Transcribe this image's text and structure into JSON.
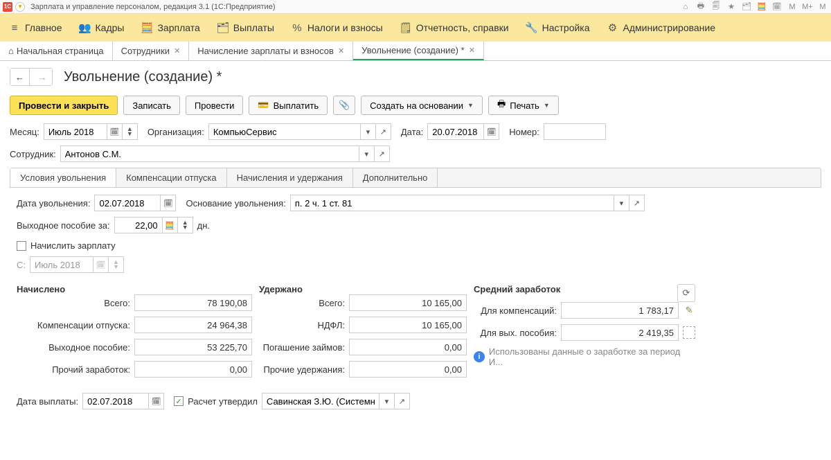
{
  "titlebar": {
    "title": "Зарплата и управление персоналом, редакция 3.1  (1С:Предприятие)",
    "right": [
      "⌂",
      "🖶",
      "🗐",
      "★",
      "🗂",
      "🧮",
      "🗓",
      "M",
      "M+",
      "M"
    ]
  },
  "menu": {
    "items": [
      {
        "icon": "≡",
        "label": "Главное"
      },
      {
        "icon": "👥",
        "label": "Кадры"
      },
      {
        "icon": "🧮",
        "label": "Зарплата"
      },
      {
        "icon": "🗂",
        "label": "Выплаты"
      },
      {
        "icon": "%",
        "label": "Налоги и взносы"
      },
      {
        "icon": "🗒",
        "label": "Отчетность, справки"
      },
      {
        "icon": "🔧",
        "label": "Настройка"
      },
      {
        "icon": "⚙",
        "label": "Администрирование"
      }
    ]
  },
  "tabs": {
    "home_label": "Начальная страница",
    "items": [
      {
        "label": "Сотрудники"
      },
      {
        "label": "Начисление зарплаты и взносов"
      },
      {
        "label": "Увольнение (создание) *",
        "active": true
      }
    ]
  },
  "heading": "Увольнение (создание) *",
  "toolbar": {
    "post_close": "Провести и закрыть",
    "save": "Записать",
    "post": "Провести",
    "pay": "Выплатить",
    "create_on": "Создать на основании",
    "print": "Печать"
  },
  "form": {
    "month_label": "Месяц:",
    "month_value": "Июль 2018",
    "org_label": "Организация:",
    "org_value": "КомпьюСервис",
    "date_label": "Дата:",
    "date_value": "20.07.2018",
    "number_label": "Номер:",
    "number_value": "",
    "employee_label": "Сотрудник:",
    "employee_value": "Антонов С.М."
  },
  "subtabs": {
    "t1": "Условия увольнения",
    "t2": "Компенсации отпуска",
    "t3": "Начисления и удержания",
    "t4": "Дополнительно"
  },
  "dismissal": {
    "date_label": "Дата увольнения:",
    "date_value": "02.07.2018",
    "basis_label": "Основание увольнения:",
    "basis_value": "п. 2 ч. 1 ст. 81",
    "severance_label": "Выходное пособие за:",
    "severance_days": "22,00",
    "days_suffix": "дн.",
    "accrue_salary": "Начислить зарплату",
    "from_label": "С:",
    "from_value": "Июль 2018"
  },
  "totals": {
    "accrued_header": "Начислено",
    "withheld_header": "Удержано",
    "avg_header": "Средний заработок",
    "accrued": {
      "total_lbl": "Всего:",
      "total": "78 190,08",
      "vacation_lbl": "Компенсации отпуска:",
      "vacation": "24 964,38",
      "severance_lbl": "Выходное пособие:",
      "severance": "53 225,70",
      "other_lbl": "Прочий заработок:",
      "other": "0,00"
    },
    "withheld": {
      "total_lbl": "Всего:",
      "total": "10 165,00",
      "ndfl_lbl": "НДФЛ:",
      "ndfl": "10 165,00",
      "loans_lbl": "Погашение займов:",
      "loans": "0,00",
      "other_lbl": "Прочие удержания:",
      "other": "0,00"
    },
    "avg": {
      "comp_lbl": "Для компенсаций:",
      "comp": "1 783,17",
      "sev_lbl": "Для вых. пособия:",
      "sev": "2 419,35",
      "note": "Использованы данные о заработке за период И..."
    }
  },
  "footer": {
    "paydate_label": "Дата выплаты:",
    "paydate": "02.07.2018",
    "approved_label": "Расчет утвердил",
    "approver": "Савинская З.Ю. (Системнь"
  }
}
